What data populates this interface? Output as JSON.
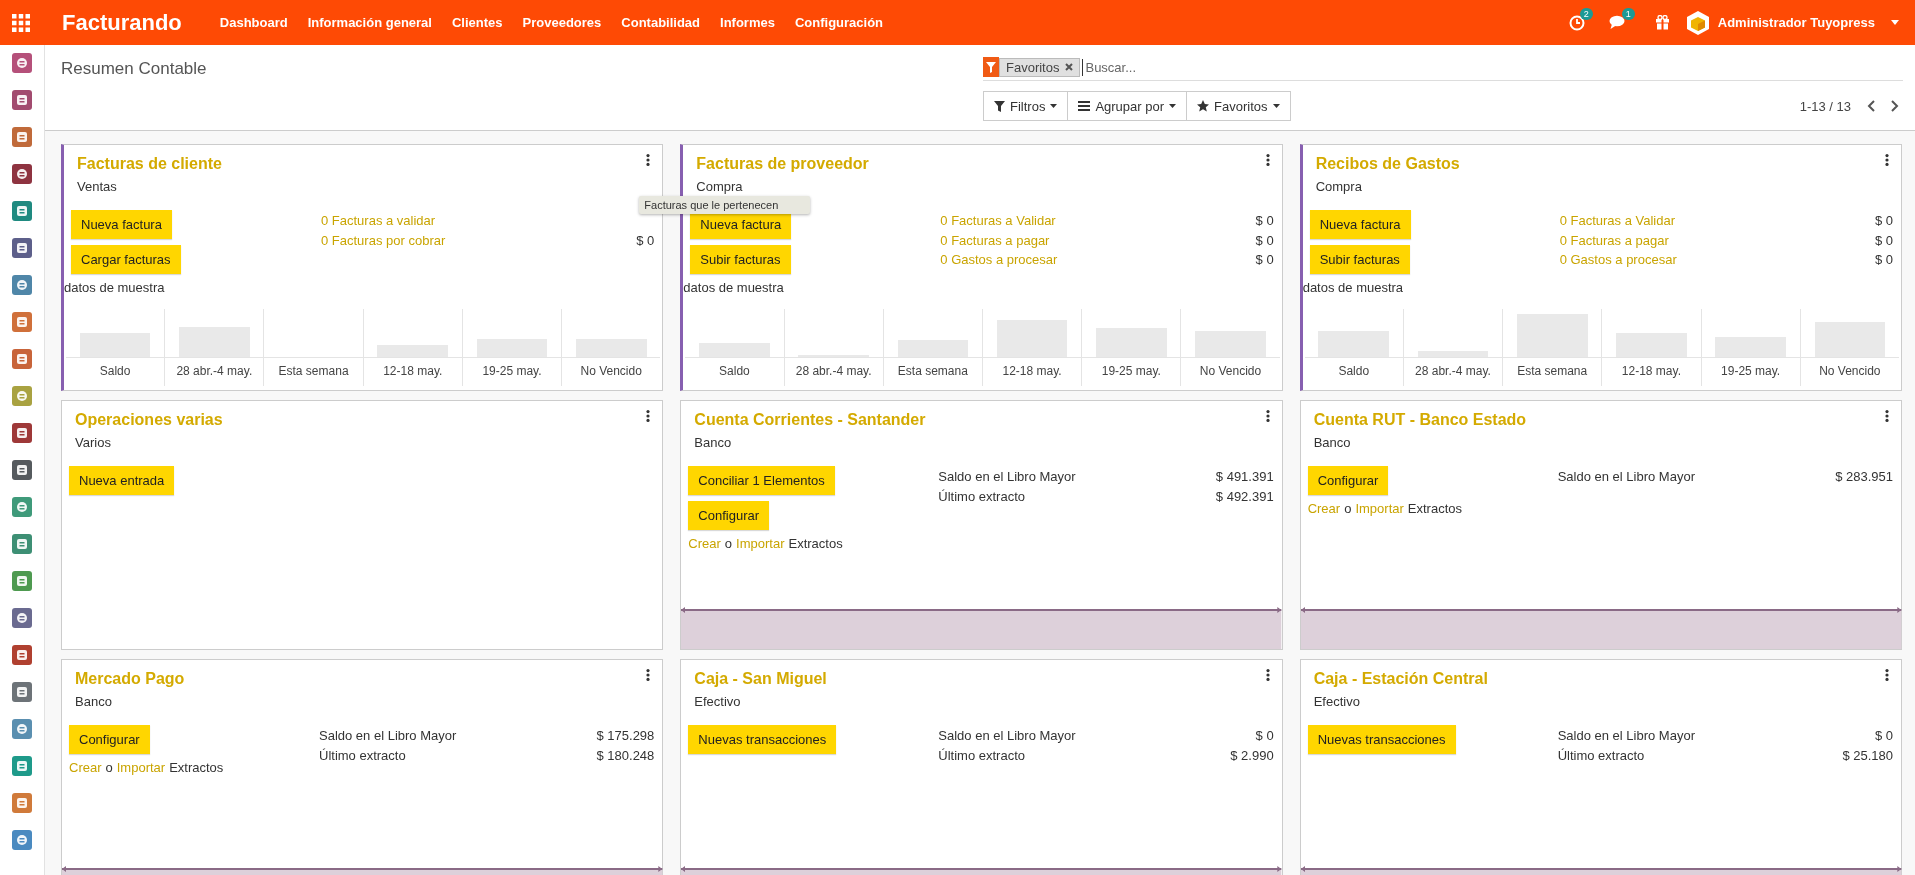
{
  "navbar": {
    "brand": "Facturando",
    "menu": [
      "Dashboard",
      "Información general",
      "Clientes",
      "Proveedores",
      "Contabilidad",
      "Informes",
      "Configuración"
    ],
    "activity_badge": "2",
    "messages_badge": "1",
    "user": "Administrador Tuyopress"
  },
  "control_panel": {
    "breadcrumb": "Resumen Contable",
    "facet": "Favoritos",
    "search_placeholder": "Buscar...",
    "buttons": [
      "Filtros",
      "Agrupar por",
      "Favoritos"
    ],
    "pager": "1-13 / 13"
  },
  "tooltip": "Facturas que le pertenecen",
  "cards": [
    {
      "kind": "chart",
      "title": "Facturas de cliente",
      "subtitle": "Ventas",
      "buttons": [
        "Nueva factura",
        "Cargar facturas"
      ],
      "stats": [
        {
          "label": "0 Facturas a validar",
          "link": true
        },
        {
          "label": "0 Facturas por cobrar",
          "value": "$ 0",
          "link": true
        }
      ],
      "sample_label": "datos de muestra",
      "chart_labels": [
        "Saldo",
        "28 abr.-4 may.",
        "Esta semana",
        "12-18 may.",
        "19-25 may.",
        "No Vencido"
      ]
    },
    {
      "kind": "chart",
      "title": "Facturas de proveedor",
      "subtitle": "Compra",
      "buttons": [
        "Nueva factura",
        "Subir facturas"
      ],
      "stats": [
        {
          "label": "0 Facturas a Validar",
          "value": "$ 0",
          "link": true
        },
        {
          "label": "0 Facturas a pagar",
          "value": "$ 0",
          "link": true
        },
        {
          "label": "0 Gastos a procesar",
          "value": "$ 0",
          "link": true
        }
      ],
      "sample_label": "datos de muestra",
      "chart_labels": [
        "Saldo",
        "28 abr.-4 may.",
        "Esta semana",
        "12-18 may.",
        "19-25 may.",
        "No Vencido"
      ]
    },
    {
      "kind": "chart",
      "title": "Recibos de Gastos",
      "subtitle": "Compra",
      "buttons": [
        "Nueva factura",
        "Subir facturas"
      ],
      "stats": [
        {
          "label": "0 Facturas a Validar",
          "value": "$ 0",
          "link": true
        },
        {
          "label": "0 Facturas a pagar",
          "value": "$ 0",
          "link": true
        },
        {
          "label": "0 Gastos a procesar",
          "value": "$ 0",
          "link": true
        }
      ],
      "sample_label": "datos de muestra",
      "chart_labels": [
        "Saldo",
        "28 abr.-4 may.",
        "Esta semana",
        "12-18 may.",
        "19-25 may.",
        "No Vencido"
      ]
    },
    {
      "kind": "plain",
      "title": "Operaciones varias",
      "subtitle": "Varios",
      "buttons": [
        "Nueva entrada"
      ]
    },
    {
      "kind": "graph",
      "title": "Cuenta Corrientes - Santander",
      "subtitle": "Banco",
      "buttons": [
        "Conciliar 1 Elementos",
        "Configurar"
      ],
      "stats": [
        {
          "label": "Saldo en el Libro Mayor",
          "value": "$ 491.391",
          "link": false
        },
        {
          "label": "Último extracto",
          "value": "$ 492.391",
          "link": false
        }
      ],
      "footer": {
        "create": "Crear",
        "or": "o",
        "import": "Importar",
        "suffix": "Extractos"
      }
    },
    {
      "kind": "graph",
      "title": "Cuenta RUT - Banco Estado",
      "subtitle": "Banco",
      "buttons": [
        "Configurar"
      ],
      "stats": [
        {
          "label": "Saldo en el Libro Mayor",
          "value": "$ 283.951",
          "link": false
        }
      ],
      "footer": {
        "create": "Crear",
        "or": "o",
        "import": "Importar",
        "suffix": "Extractos"
      }
    },
    {
      "kind": "graph",
      "title": "Mercado Pago",
      "subtitle": "Banco",
      "buttons": [
        "Configurar"
      ],
      "stats": [
        {
          "label": "Saldo en el Libro Mayor",
          "value": "$ 175.298",
          "link": false
        },
        {
          "label": "Último extracto",
          "value": "$ 180.248",
          "link": false
        }
      ],
      "footer": {
        "create": "Crear",
        "or": "o",
        "import": "Importar",
        "suffix": "Extractos"
      }
    },
    {
      "kind": "graph",
      "title": "Caja - San Miguel",
      "subtitle": "Efectivo",
      "buttons": [
        "Nuevas transacciones"
      ],
      "stats": [
        {
          "label": "Saldo en el Libro Mayor",
          "value": "$ 0",
          "link": false
        },
        {
          "label": "Último extracto",
          "value": "$ 2.990",
          "link": false
        }
      ]
    },
    {
      "kind": "graph",
      "title": "Caja - Estación Central",
      "subtitle": "Efectivo",
      "buttons": [
        "Nuevas transacciones"
      ],
      "stats": [
        {
          "label": "Saldo en el Libro Mayor",
          "value": "$ 0",
          "link": false
        },
        {
          "label": "Último extracto",
          "value": "$ 25.180",
          "link": false
        }
      ]
    }
  ]
}
